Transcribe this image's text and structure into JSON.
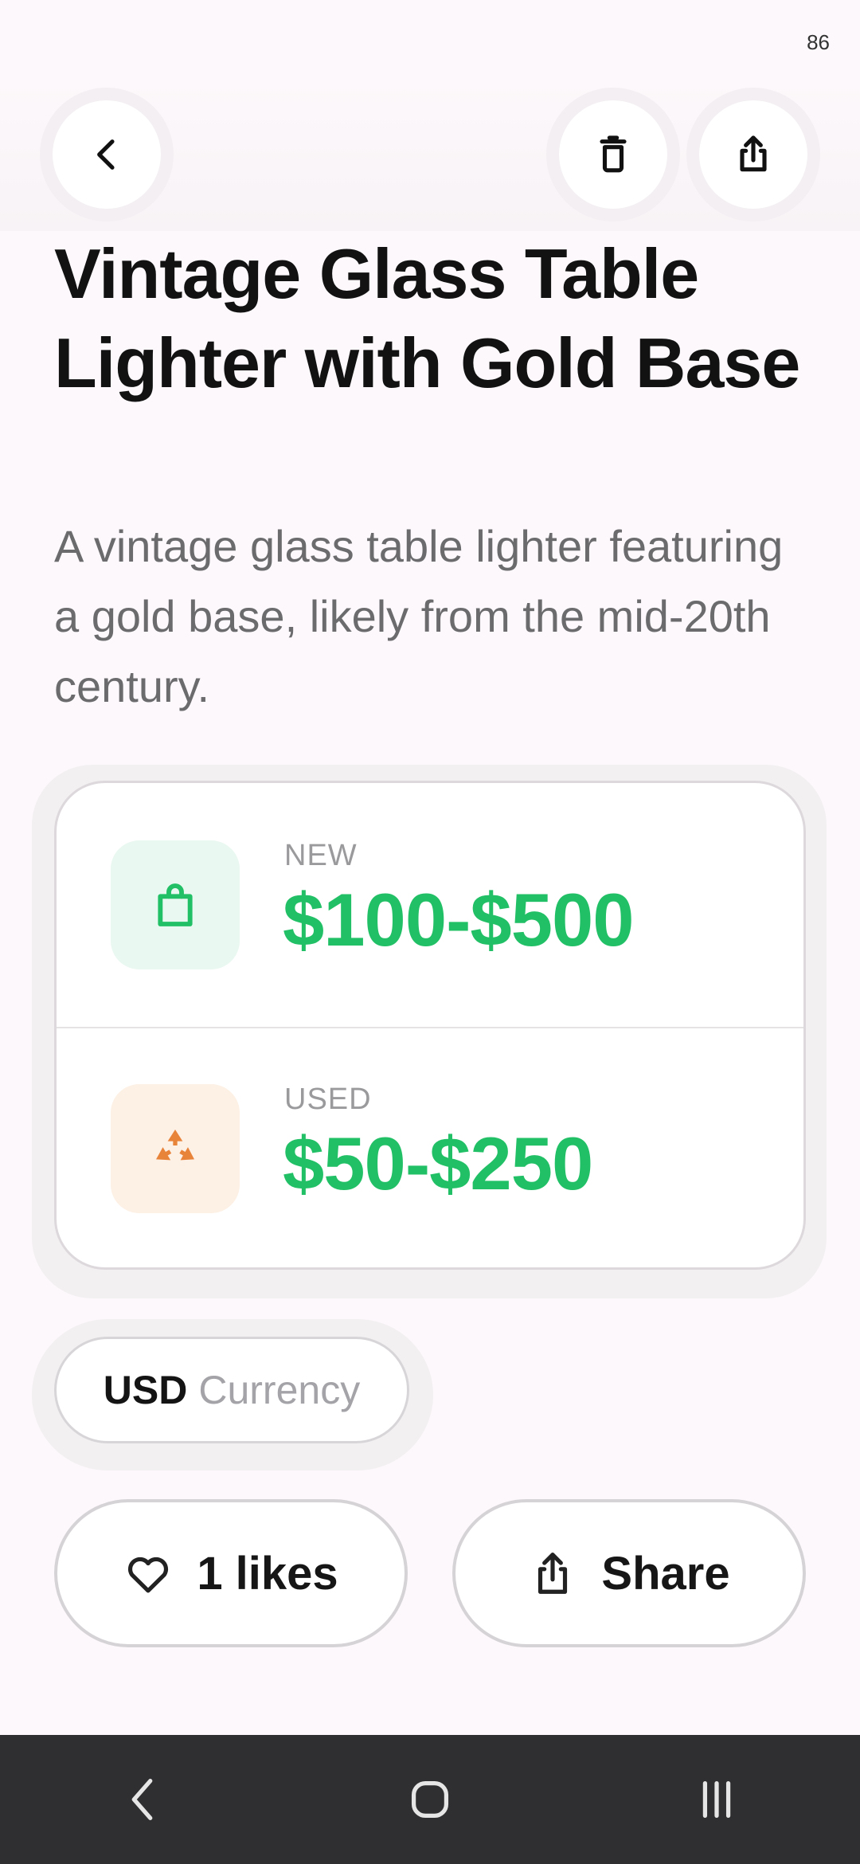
{
  "status_bar": {
    "battery": "86"
  },
  "top_bar": {
    "back_icon": "chevron-left-icon",
    "delete_icon": "trash-icon",
    "share_icon": "share-icon"
  },
  "item": {
    "title": "Vintage Glass Table Lighter with Gold Base",
    "description": "A vintage glass table lighter featuring a gold base, likely from the mid-20th century."
  },
  "prices": {
    "new": {
      "label": "NEW",
      "value": "$100-$500",
      "icon": "shopping-bag-icon",
      "icon_color": "#22c066",
      "bg_color": "#e9f8f0"
    },
    "used": {
      "label": "USED",
      "value": "$50-$250",
      "icon": "recycle-icon",
      "icon_color": "#e8833a",
      "bg_color": "#fdf0e4"
    },
    "value_color": "#22c066"
  },
  "currency": {
    "code": "USD",
    "label": "Currency"
  },
  "actions": {
    "likes_label": "1 likes",
    "share_label": "Share"
  },
  "nav": {
    "back": "nav-back-icon",
    "home": "nav-home-icon",
    "recents": "nav-recents-icon"
  }
}
